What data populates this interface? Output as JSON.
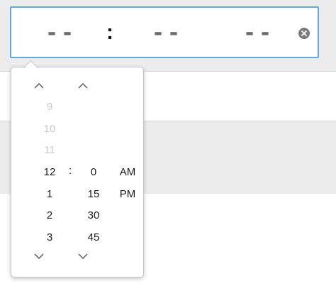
{
  "time_input": {
    "hour": "--",
    "separator": ":",
    "minute": "--",
    "ampm": "--",
    "clear_icon": "clear-circle-x-icon"
  },
  "picker": {
    "hours": [
      "9",
      "10",
      "11",
      "12",
      "1",
      "2",
      "3"
    ],
    "selected_hour": "12",
    "separator": ":",
    "minutes": [
      "0",
      "15",
      "30",
      "45"
    ],
    "selected_minute": "0",
    "periods": [
      "AM",
      "PM"
    ],
    "selected_period": "AM",
    "up_icon": "chevron-up-icon",
    "down_icon": "chevron-down-icon"
  },
  "colors": {
    "focus_border": "#5fa8e6",
    "faded_text": "#c9c9c9",
    "placeholder": "#6d6d6d"
  }
}
